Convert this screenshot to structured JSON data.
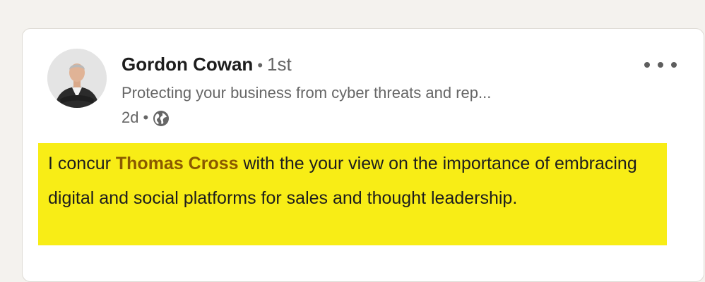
{
  "post": {
    "author_name": "Gordon Cowan",
    "separator": "•",
    "connection_degree": "1st",
    "headline": "Protecting your business from cyber threats and rep...",
    "timestamp": "2d",
    "meta_separator": "•",
    "visibility_icon": "globe-icon",
    "more_icon": "more-options-icon"
  },
  "comment": {
    "text_before": "I concur ",
    "mention": "Thomas Cross",
    "text_after": " with the your view on the importance of embracing digital and social platforms for sales and thought leadership."
  },
  "colors": {
    "highlight": "#f8ed16",
    "mention": "#8a5a00",
    "page_bg": "#f4f2ee"
  }
}
